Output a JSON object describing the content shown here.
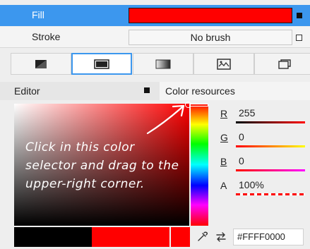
{
  "brush": {
    "fill_label": "Fill",
    "fill_color": "#FF0000",
    "stroke_label": "Stroke",
    "stroke_value": "No brush"
  },
  "brush_tabs": [
    {
      "icon": "no-brush-icon",
      "active": false
    },
    {
      "icon": "solid-color-brush-icon",
      "active": true
    },
    {
      "icon": "gradient-brush-icon",
      "active": false
    },
    {
      "icon": "image-brush-icon",
      "active": false
    },
    {
      "icon": "brush-resources-icon",
      "active": false
    }
  ],
  "editor": {
    "title": "Editor",
    "resources_title": "Color resources",
    "instruction": "Click in this color selector and drag to the upper-right corner."
  },
  "channels": {
    "r_label": "R",
    "r_value": "255",
    "g_label": "G",
    "g_value": "0",
    "b_label": "B",
    "b_value": "0",
    "a_label": "A",
    "a_value": "100%"
  },
  "hex_value": "#FFFF0000",
  "colors": {
    "accent": "#3C97EE",
    "selected": "#FF0000",
    "previous": "#000000"
  }
}
